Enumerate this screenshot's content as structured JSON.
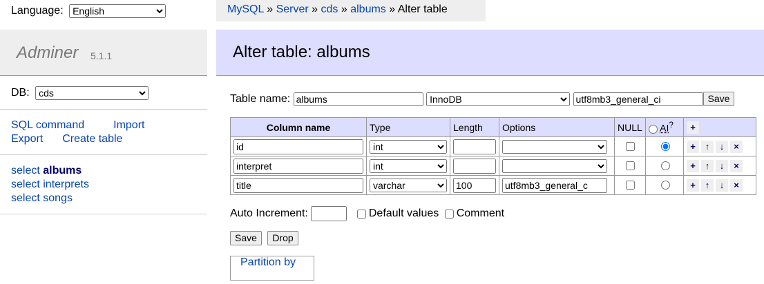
{
  "sidebar": {
    "language_label": "Language:",
    "language_value": "English",
    "brand_name": "Adminer",
    "brand_version": "5.1.1",
    "db_label": "DB:",
    "db_value": "cds",
    "links": [
      "SQL command",
      "Import",
      "Export",
      "Create table"
    ],
    "tables": [
      {
        "prefix": "select",
        "name": "albums",
        "active": true
      },
      {
        "prefix": "select",
        "name": "interprets",
        "active": false
      },
      {
        "prefix": "select",
        "name": "songs",
        "active": false
      }
    ]
  },
  "breadcrumb": {
    "items": [
      "MySQL",
      "Server",
      "cds",
      "albums"
    ],
    "current": "Alter table",
    "separator": "»"
  },
  "page": {
    "title": "Alter table: albums"
  },
  "form": {
    "table_name_label": "Table name:",
    "table_name_value": "albums",
    "engine": "InnoDB",
    "collation": "utf8mb3_general_ci",
    "save_label": "Save"
  },
  "columns_table": {
    "headers": {
      "column_name": "Column name",
      "type": "Type",
      "length": "Length",
      "options": "Options",
      "null": "NULL",
      "ai": "AI",
      "ai_sup": "?"
    },
    "rows": [
      {
        "name": "id",
        "type": "int",
        "length": "",
        "options": "",
        "null": false,
        "ai": true
      },
      {
        "name": "interpret",
        "type": "int",
        "length": "",
        "options": "",
        "null": false,
        "ai": false
      },
      {
        "name": "title",
        "type": "varchar",
        "length": "100",
        "options": "utf8mb3_general_c",
        "null": false,
        "ai": false
      }
    ]
  },
  "bottom": {
    "auto_increment_label": "Auto Increment:",
    "auto_increment_value": "",
    "default_values_label": "Default values",
    "comment_label": "Comment",
    "save_label": "Save",
    "drop_label": "Drop",
    "partition_label": "Partition by"
  },
  "icons": {
    "add": "+",
    "up": "↑",
    "down": "↓",
    "remove": "×"
  },
  "colors": {
    "link": "#0645ad",
    "header_bg": "#ddf",
    "panel_bg": "#eee"
  }
}
